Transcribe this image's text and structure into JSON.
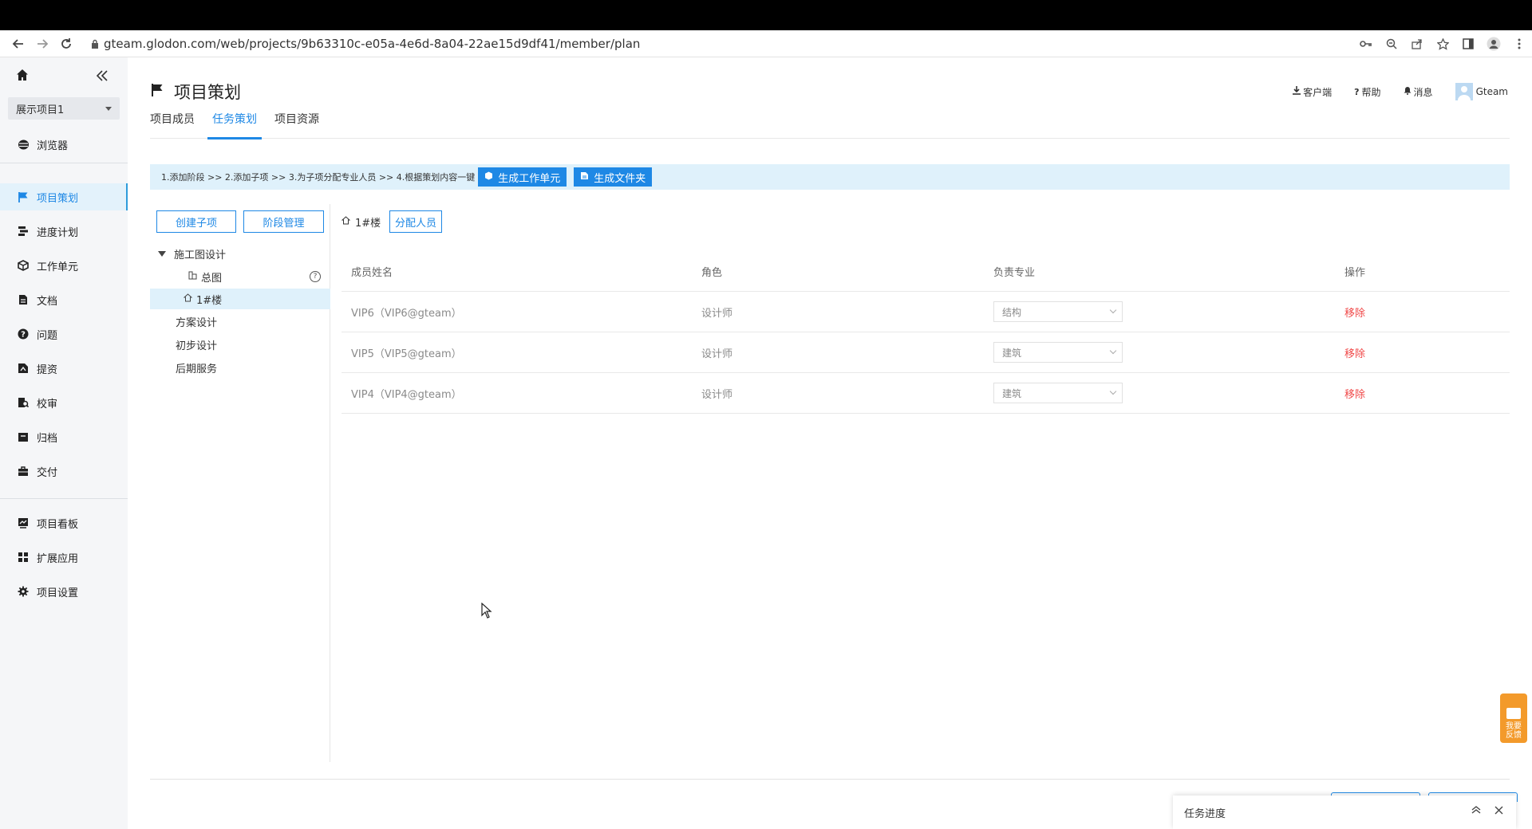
{
  "browser": {
    "url": "gteam.glodon.com/web/projects/9b63310c-e05a-4e6d-8a04-22ae15d9df41/member/plan"
  },
  "sidebar": {
    "project_select": "展示项目1",
    "items": [
      {
        "label": "浏览器",
        "icon": "globe-icon"
      },
      {
        "label": "项目策划",
        "icon": "flag-icon",
        "active": true
      },
      {
        "label": "进度计划",
        "icon": "schedule-icon"
      },
      {
        "label": "工作单元",
        "icon": "cube-icon"
      },
      {
        "label": "文档",
        "icon": "document-icon"
      },
      {
        "label": "问题",
        "icon": "question-icon"
      },
      {
        "label": "提资",
        "icon": "submit-icon"
      },
      {
        "label": "校审",
        "icon": "review-icon"
      },
      {
        "label": "归档",
        "icon": "archive-icon"
      },
      {
        "label": "交付",
        "icon": "briefcase-icon"
      },
      {
        "label": "项目看板",
        "icon": "dashboard-icon"
      },
      {
        "label": "扩展应用",
        "icon": "apps-icon"
      },
      {
        "label": "项目设置",
        "icon": "gear-icon"
      }
    ]
  },
  "header": {
    "title": "项目策划",
    "actions": {
      "client": "客户端",
      "help": "帮助",
      "messages": "消息",
      "user": "Gteam"
    }
  },
  "tabs": [
    "项目成员",
    "任务策划",
    "项目资源"
  ],
  "guide": {
    "steps": "1.添加阶段 >> 2.添加子项 >> 3.为子项分配专业人员 >> 4.根据策划内容一键",
    "btn_workunit": "生成工作单元",
    "btn_folder": "生成文件夹"
  },
  "tree": {
    "create_child": "创建子项",
    "stage_manage": "阶段管理",
    "nodes": {
      "construction": "施工图设计",
      "general": "总图",
      "building1": "1#楼",
      "scheme": "方案设计",
      "preliminary": "初步设计",
      "post_service": "后期服务"
    }
  },
  "content": {
    "crumb": "1#楼",
    "assign_btn": "分配人员",
    "columns": [
      "成员姓名",
      "角色",
      "负责专业",
      "操作"
    ],
    "rows": [
      {
        "name": "VIP6（VIP6@gteam）",
        "role": "设计师",
        "specialty": "结构",
        "action": "移除"
      },
      {
        "name": "VIP5（VIP5@gteam）",
        "role": "设计师",
        "specialty": "建筑",
        "action": "移除"
      },
      {
        "name": "VIP4（VIP4@gteam）",
        "role": "设计师",
        "specialty": "建筑",
        "action": "移除"
      }
    ]
  },
  "task_panel": {
    "title": "任务进度"
  },
  "feedback": {
    "label_line1": "我要",
    "label_line2": "反馈"
  }
}
